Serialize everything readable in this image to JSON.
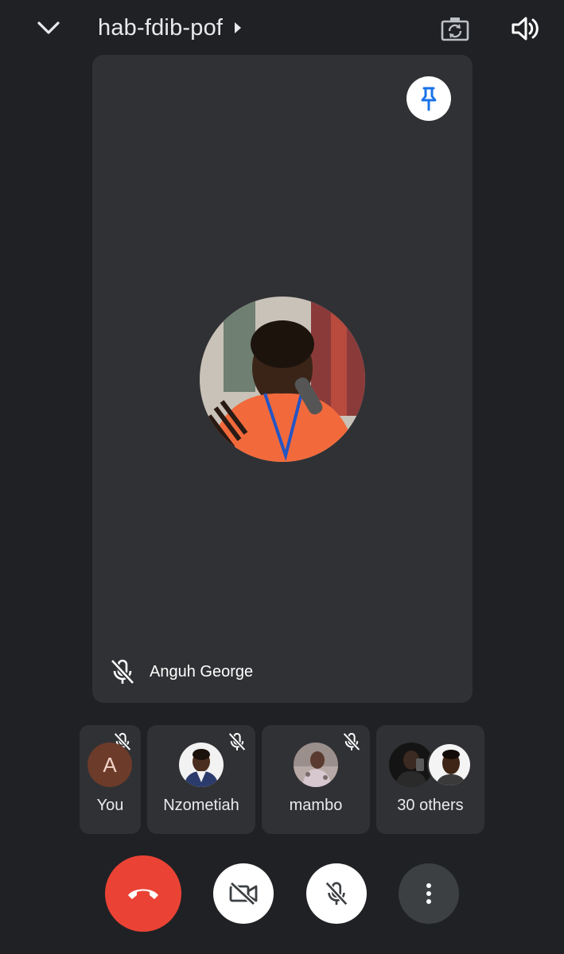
{
  "header": {
    "meeting_code": "hab-fdib-pof",
    "collapse_icon": "chevron-down-icon",
    "info_icon": "caret-right-icon",
    "camera_switch_icon": "camera-switch-icon",
    "speaker_icon": "speaker-icon"
  },
  "main_tile": {
    "participant_name": "Anguh George",
    "pin_icon": "pin-icon",
    "mic_status_icon": "mic-off-icon",
    "pin_color": "#1a73e8"
  },
  "participants": [
    {
      "label": "You",
      "initial": "A",
      "muted": true
    },
    {
      "label": "Nzometiah",
      "muted": true
    },
    {
      "label": "mambo",
      "muted": true
    },
    {
      "label": "30 others"
    }
  ],
  "controls": {
    "end_call_icon": "end-call-icon",
    "end_call_color": "#ea4335",
    "camera_icon": "camera-off-icon",
    "mic_icon": "mic-off-icon",
    "more_icon": "more-vert-icon"
  },
  "colors": {
    "background": "#202124",
    "tile": "#303134",
    "text": "#e8eaed"
  }
}
